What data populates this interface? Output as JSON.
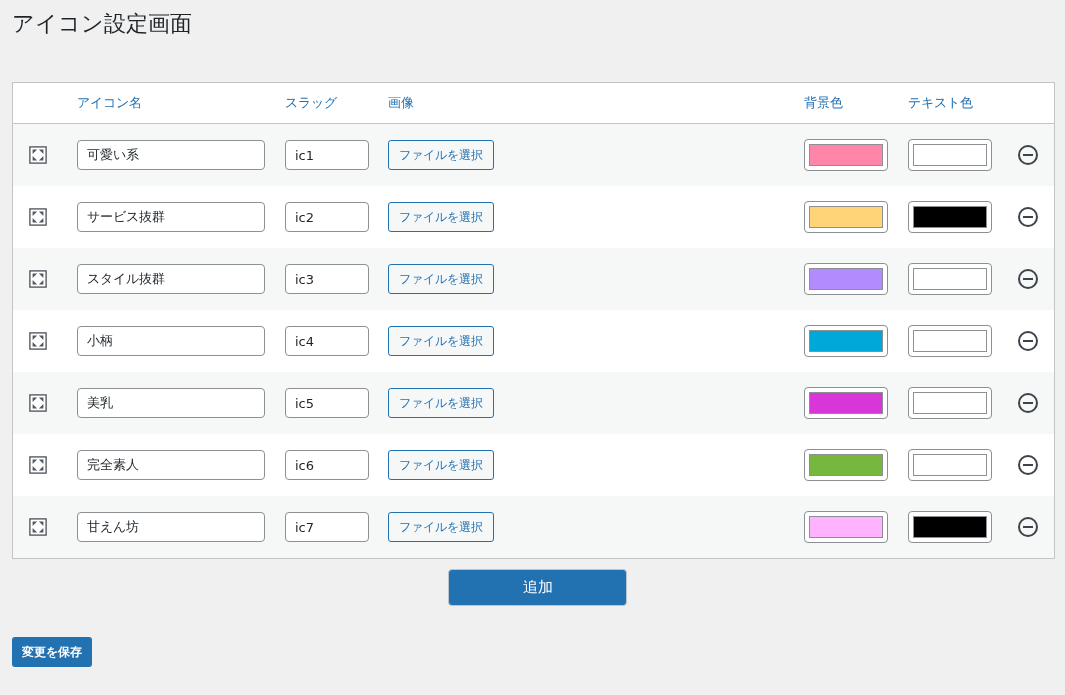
{
  "page_title": "アイコン設定画面",
  "table": {
    "columns": [
      "アイコン名",
      "スラッグ",
      "画像",
      "背景色",
      "テキスト色"
    ],
    "rows": [
      {
        "name": "可愛い系",
        "slug": "ic1",
        "file_button": "ファイルを選択",
        "background_swatch": {
          "color": "#ff85a9"
        },
        "text_swatch": {
          "color": "#ffffff"
        }
      },
      {
        "name": "サービス抜群",
        "slug": "ic2",
        "file_button": "ファイルを選択",
        "background_swatch": {
          "color": "#ffd479"
        },
        "text_swatch": {
          "color": "#000000"
        }
      },
      {
        "name": "スタイル抜群",
        "slug": "ic3",
        "file_button": "ファイルを選択",
        "background_swatch": {
          "color": "#b28cff"
        },
        "text_swatch": {
          "color": "#ffffff"
        }
      },
      {
        "name": "小柄",
        "slug": "ic4",
        "file_button": "ファイルを選択",
        "background_swatch": {
          "color": "#00a8d9"
        },
        "text_swatch": {
          "color": "#ffffff"
        }
      },
      {
        "name": "美乳",
        "slug": "ic5",
        "file_button": "ファイルを選択",
        "background_swatch": {
          "color": "#d936d9"
        },
        "text_swatch": {
          "color": "#ffffff"
        }
      },
      {
        "name": "完全素人",
        "slug": "ic6",
        "file_button": "ファイルを選択",
        "background_swatch": {
          "color": "#75b83d"
        },
        "text_swatch": {
          "color": "#ffffff"
        }
      },
      {
        "name": "甘えん坊",
        "slug": "ic7",
        "file_button": "ファイルを選択",
        "background_swatch": {
          "color": "#ffb3ff"
        },
        "text_swatch": {
          "color": "#000000"
        }
      }
    ]
  },
  "add_button": "追加",
  "save_button": "変更を保存"
}
